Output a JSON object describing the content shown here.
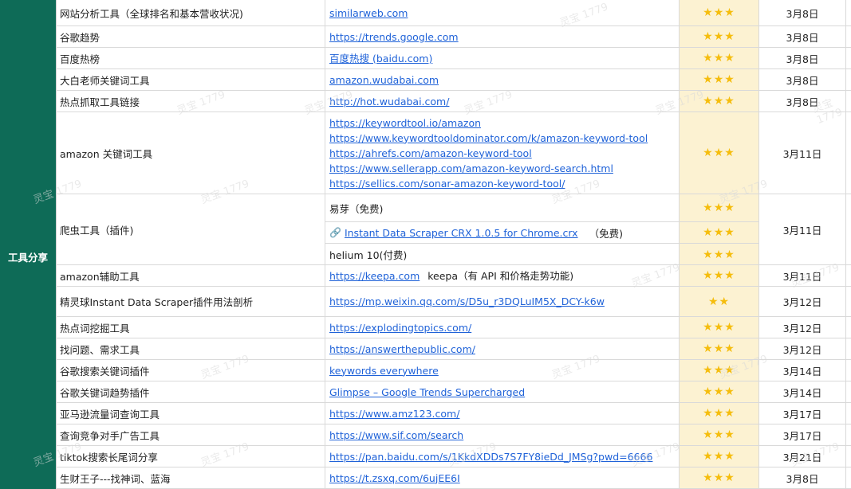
{
  "category": "工具分享",
  "rows": [
    {
      "name": "网站分析工具（全球排名和基本营收状况)",
      "links": [
        "similarweb.com"
      ],
      "stars": "★★★",
      "date": "3月8日"
    },
    {
      "name": "谷歌趋势",
      "links": [
        "https://trends.google.com"
      ],
      "stars": "★★★",
      "date": "3月8日"
    },
    {
      "name": "百度热榜",
      "links": [
        "百度热搜 (baidu.com)"
      ],
      "stars": "★★★",
      "date": "3月8日"
    },
    {
      "name": "大白老师关键词工具",
      "links": [
        "amazon.wudabai.com"
      ],
      "stars": "★★★",
      "date": "3月8日"
    },
    {
      "name": "热点抓取工具链接",
      "links": [
        "http://hot.wudabai.com/"
      ],
      "stars": "★★★",
      "date": "3月8日"
    },
    {
      "name": "amazon 关键词工具",
      "links": [
        "https://keywordtool.io/amazon",
        "https://www.keywordtooldominator.com/k/amazon-keyword-tool",
        "https://ahrefs.com/amazon-keyword-tool",
        "https://www.sellerapp.com/amazon-keyword-search.html",
        "https://sellics.com/sonar-amazon-keyword-tool/"
      ],
      "stars": "★★★",
      "date": "3月11日"
    },
    {
      "name": "爬虫工具（插件)",
      "date": "3月11日",
      "subs": [
        {
          "text": "易芽（免费)",
          "stars": "★★★"
        },
        {
          "link": "Instant Data Scraper CRX 1.0.5 for Chrome.crx",
          "note": "（免费)",
          "stars": "★★★"
        },
        {
          "text": "helium 10(付费)",
          "stars": "★★★"
        }
      ]
    },
    {
      "name": "amazon辅助工具",
      "links": [
        "https://keepa.com"
      ],
      "note": "keepa（有 API 和价格走势功能)",
      "stars": "★★★",
      "date": "3月11日"
    },
    {
      "name": "精灵球Instant Data Scraper插件用法剖析",
      "links": [
        "https://mp.weixin.qq.com/s/D5u_r3DQLuIM5X_DCY-k6w"
      ],
      "stars": "★★",
      "date": "3月12日"
    },
    {
      "name": "热点词挖掘工具",
      "links": [
        "https://explodingtopics.com/"
      ],
      "stars": "★★★",
      "date": "3月12日"
    },
    {
      "name": "找问题、需求工具",
      "links": [
        "https://answerthepublic.com/"
      ],
      "stars": "★★★",
      "date": "3月12日"
    },
    {
      "name": "谷歌搜索关键词插件",
      "links": [
        "keywords everywhere"
      ],
      "stars": "★★★",
      "date": "3月14日"
    },
    {
      "name": "谷歌关键词趋势插件",
      "links": [
        "Glimpse – Google Trends Supercharged"
      ],
      "stars": "★★★",
      "date": "3月14日"
    },
    {
      "name": "亚马逊流量词查询工具",
      "links": [
        "https://www.amz123.com/"
      ],
      "stars": "★★★",
      "date": "3月17日"
    },
    {
      "name": "查询竞争对手广告工具",
      "links": [
        "https://www.sif.com/search"
      ],
      "stars": "★★★",
      "date": "3月17日"
    },
    {
      "name": "tiktok搜索长尾词分享",
      "links": [
        "https://pan.baidu.com/s/1KkdXDDs7S7FY8ieDd_JMSg?pwd=6666"
      ],
      "stars": "★★★",
      "date": "3月21日"
    },
    {
      "name": "生财王子---找神词、蓝海",
      "links": [
        "https://t.zsxq.com/6ujEE6I"
      ],
      "stars": "★★★",
      "date": "3月8日"
    }
  ],
  "watermark": "灵宝 1779",
  "colors": {
    "category_bg": "#0e6b57",
    "star": "#f5bd0d",
    "star_column_bg": "#fcf2d2",
    "link": "#1f62d8"
  }
}
